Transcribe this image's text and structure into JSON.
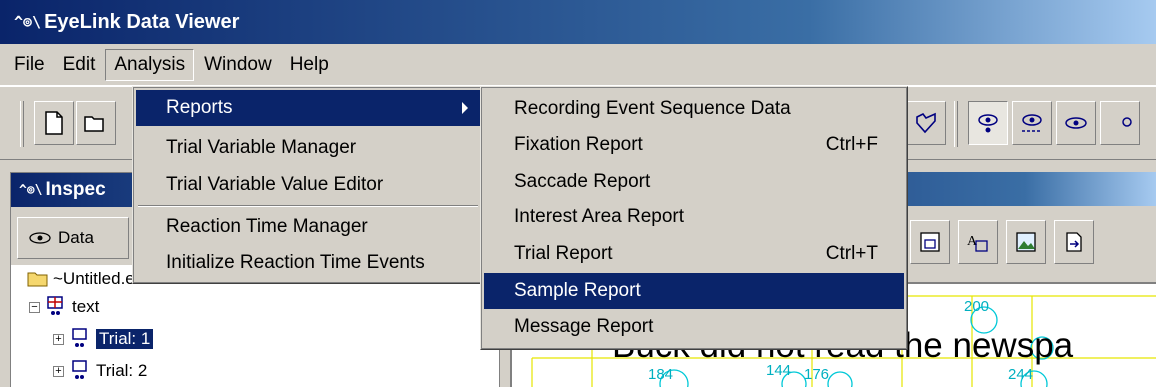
{
  "window": {
    "logo": "^⊚\\",
    "title": "EyeLink Data Viewer"
  },
  "menubar": [
    "File",
    "Edit",
    "Analysis",
    "Window",
    "Help"
  ],
  "analysis_menu": {
    "items": [
      {
        "label": "Reports"
      },
      {
        "label": "Trial Variable Manager"
      },
      {
        "label": "Trial Variable Value Editor"
      },
      {
        "label": "Reaction Time Manager"
      },
      {
        "label": "Initialize Reaction Time Events"
      }
    ]
  },
  "reports_submenu": {
    "items": [
      {
        "label": "Recording Event Sequence Data",
        "shortcut": ""
      },
      {
        "label": "Fixation Report",
        "shortcut": "Ctrl+F"
      },
      {
        "label": "Saccade Report",
        "shortcut": ""
      },
      {
        "label": "Interest Area Report",
        "shortcut": ""
      },
      {
        "label": "Trial Report",
        "shortcut": "Ctrl+T"
      },
      {
        "label": "Sample Report",
        "shortcut": ""
      },
      {
        "label": "Message Report",
        "shortcut": ""
      }
    ]
  },
  "inspector": {
    "title": "Inspec",
    "data_tab": "Data"
  },
  "tree": {
    "root": "~Untitled.ev",
    "group": "text",
    "trials": [
      "Trial: 1",
      "Trial: 2"
    ]
  },
  "canvas": {
    "sentence": "Buck did not read the newspa",
    "numbers": [
      "200",
      "184",
      "144",
      "176",
      "244"
    ]
  },
  "colors": {
    "menu_highlight": "#0a246a",
    "title_gradient_start": "#0a246a",
    "ia_boxes": "#e6e600",
    "fixations": "#00c8d7"
  }
}
